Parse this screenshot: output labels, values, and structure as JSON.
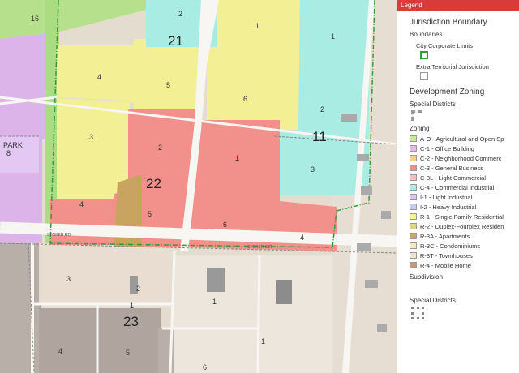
{
  "map": {
    "zone_labels": [
      "16",
      "2",
      "1",
      "1",
      "21",
      "4",
      "5",
      "6",
      "2",
      "PARK",
      "8",
      "3",
      "2",
      "1",
      "11",
      "3",
      "22",
      "4",
      "5",
      "6",
      "4",
      "3",
      "2",
      "1",
      "1",
      "23",
      "4",
      "5",
      "6",
      "1"
    ],
    "street_labels": [
      "STOKER RD",
      "STOKER CIR"
    ]
  },
  "legend": {
    "header": "Legend",
    "title": "Jurisdiction Boundary",
    "boundaries_label": "Boundaries",
    "boundary_items": [
      "City Corporate Limits",
      "Extra Territorial Jurisdiction"
    ],
    "dev_zoning_title": "Development Zoning",
    "special_districts_label": "Special Districts",
    "zoning_label": "Zoning",
    "zoning_items": [
      {
        "label": "A-O - Agricultural and Open Sp",
        "color": "#c8e89a"
      },
      {
        "label": "C-1 - Office Building",
        "color": "#e7b8e8"
      },
      {
        "label": "C-2 - Neighborhood Commerc",
        "color": "#f0d48a"
      },
      {
        "label": "C-3 - General Business",
        "color": "#f08c8c"
      },
      {
        "label": "C-3L - Light Commercial",
        "color": "#f5c0c0"
      },
      {
        "label": "C-4 - Commercial Industrial",
        "color": "#a8ece6"
      },
      {
        "label": "I-1 - Light Industrial",
        "color": "#e0c4f0"
      },
      {
        "label": "I-2 - Heavy Industrial",
        "color": "#c8c4f0"
      },
      {
        "label": "R-1 - Single Family Residential",
        "color": "#f5f09a"
      },
      {
        "label": "R-2 - Duplex-Fourplex Residen",
        "color": "#d8d48a"
      },
      {
        "label": "R-3A - Apartments",
        "color": "#c8a868"
      },
      {
        "label": "R-3C - Condominiums",
        "color": "#f5e8c0"
      },
      {
        "label": "R-3T - Townhouses",
        "color": "#f0e4cc"
      },
      {
        "label": "R-4 - Mobile Home",
        "color": "#c09a80"
      }
    ],
    "subdivision_label": "Subdivision",
    "special_districts_label_2": "Special Districts"
  },
  "colors": {
    "header_red": "#d93a3a",
    "boundary_green": "#3a9a3a"
  }
}
